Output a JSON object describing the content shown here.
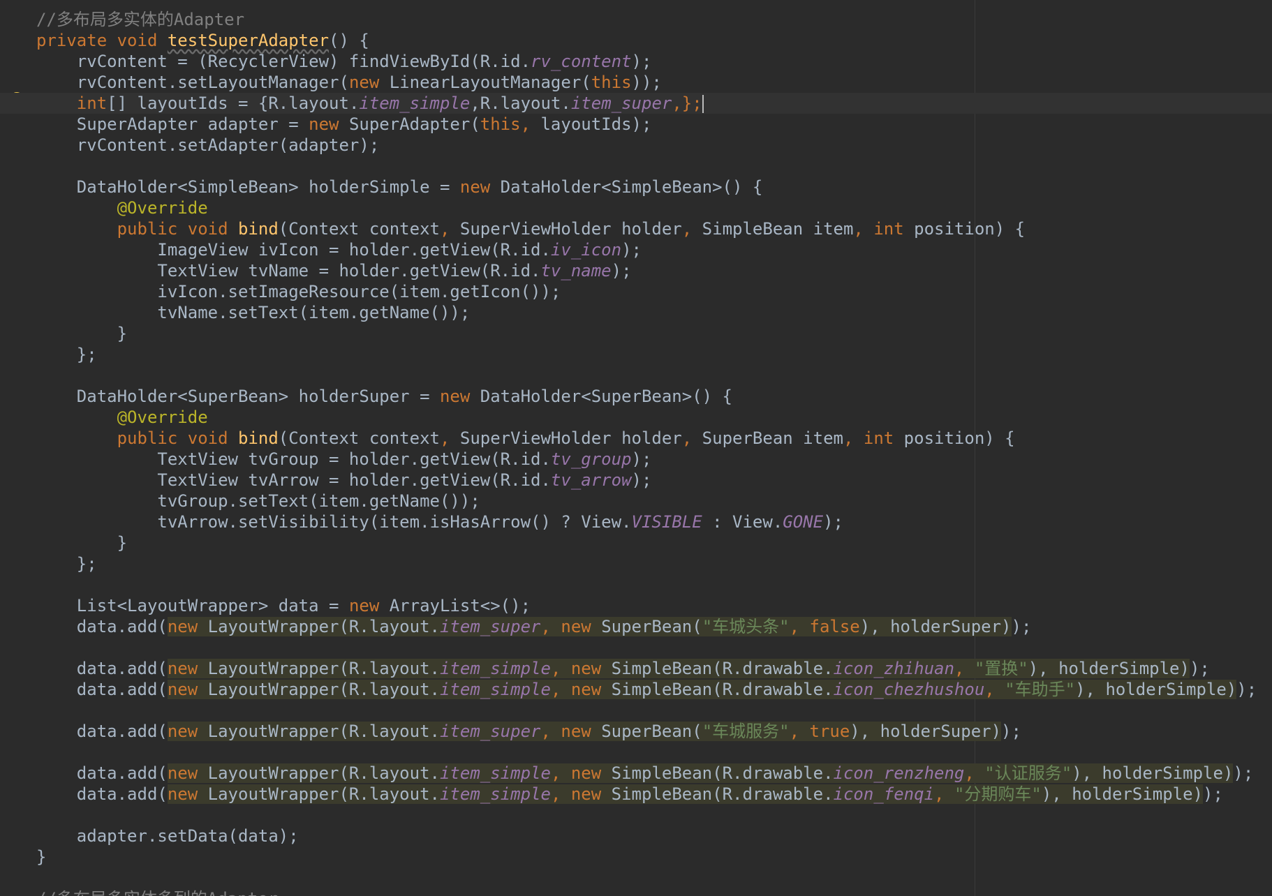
{
  "editor": {
    "lines": [
      [
        {
          "t": "//多布局多实体的Adapter",
          "c": "cm"
        }
      ],
      [
        {
          "t": "private void ",
          "c": "kw"
        },
        {
          "t": "testSuperAdapter",
          "c": "fn uline"
        },
        {
          "t": "() {",
          "c": "pl"
        }
      ],
      [
        {
          "t": "    rvContent = (RecyclerView) findViewById(R.id.",
          "c": "pl"
        },
        {
          "t": "rv_content",
          "c": "fd"
        },
        {
          "t": ");",
          "c": "pl"
        }
      ],
      [
        {
          "t": "    rvContent.setLayoutManager(",
          "c": "pl"
        },
        {
          "t": "new ",
          "c": "kw"
        },
        {
          "t": "LinearLayoutManager(",
          "c": "pl"
        },
        {
          "t": "this",
          "c": "kw"
        },
        {
          "t": "));",
          "c": "pl"
        }
      ],
      [
        {
          "t": "    ",
          "c": "pl"
        },
        {
          "t": "int",
          "c": "kw"
        },
        {
          "t": "[] layoutIds = {R.layout.",
          "c": "pl"
        },
        {
          "t": "item_simple",
          "c": "fd"
        },
        {
          "t": ",R.layout.",
          "c": "pl"
        },
        {
          "t": "item_super",
          "c": "fd"
        },
        {
          "t": ",};",
          "c": "kw"
        }
      ],
      [
        {
          "t": "    SuperAdapter adapter = ",
          "c": "pl"
        },
        {
          "t": "new ",
          "c": "kw"
        },
        {
          "t": "SuperAdapter(",
          "c": "pl"
        },
        {
          "t": "this",
          "c": "kw"
        },
        {
          "t": ", ",
          "c": "kw"
        },
        {
          "t": "layoutIds);",
          "c": "pl"
        }
      ],
      [
        {
          "t": "    rvContent.setAdapter(adapter);",
          "c": "pl"
        }
      ],
      [
        {
          "t": "",
          "c": "pl"
        }
      ],
      [
        {
          "t": "    DataHolder<SimpleBean> holderSimple = ",
          "c": "pl"
        },
        {
          "t": "new ",
          "c": "kw"
        },
        {
          "t": "DataHolder<SimpleBean>() {",
          "c": "pl"
        }
      ],
      [
        {
          "t": "        ",
          "c": "pl"
        },
        {
          "t": "@Override",
          "c": "an"
        }
      ],
      [
        {
          "t": "        ",
          "c": "pl"
        },
        {
          "t": "public void ",
          "c": "kw"
        },
        {
          "t": "bind",
          "c": "fn"
        },
        {
          "t": "(Context context",
          "c": "pl"
        },
        {
          "t": ", ",
          "c": "kw"
        },
        {
          "t": "SuperViewHolder holder",
          "c": "pl"
        },
        {
          "t": ", ",
          "c": "kw"
        },
        {
          "t": "SimpleBean item",
          "c": "pl"
        },
        {
          "t": ", int ",
          "c": "kw"
        },
        {
          "t": "position) {",
          "c": "pl"
        }
      ],
      [
        {
          "t": "            ImageView ivIcon = holder.getView(R.id.",
          "c": "pl"
        },
        {
          "t": "iv_icon",
          "c": "fd"
        },
        {
          "t": ");",
          "c": "pl"
        }
      ],
      [
        {
          "t": "            TextView tvName = holder.getView(R.id.",
          "c": "pl"
        },
        {
          "t": "tv_name",
          "c": "fd"
        },
        {
          "t": ");",
          "c": "pl"
        }
      ],
      [
        {
          "t": "            ivIcon.setImageResource(item.getIcon());",
          "c": "pl"
        }
      ],
      [
        {
          "t": "            tvName.setText(item.getName());",
          "c": "pl"
        }
      ],
      [
        {
          "t": "        }",
          "c": "pl"
        }
      ],
      [
        {
          "t": "    };",
          "c": "pl"
        }
      ],
      [
        {
          "t": "",
          "c": "pl"
        }
      ],
      [
        {
          "t": "    DataHolder<SuperBean> holderSuper = ",
          "c": "pl"
        },
        {
          "t": "new ",
          "c": "kw"
        },
        {
          "t": "DataHolder<SuperBean>() {",
          "c": "pl"
        }
      ],
      [
        {
          "t": "        ",
          "c": "pl"
        },
        {
          "t": "@Override",
          "c": "an"
        }
      ],
      [
        {
          "t": "        ",
          "c": "pl"
        },
        {
          "t": "public void ",
          "c": "kw"
        },
        {
          "t": "bind",
          "c": "fn"
        },
        {
          "t": "(Context context",
          "c": "pl"
        },
        {
          "t": ", ",
          "c": "kw"
        },
        {
          "t": "SuperViewHolder holder",
          "c": "pl"
        },
        {
          "t": ", ",
          "c": "kw"
        },
        {
          "t": "SuperBean item",
          "c": "pl"
        },
        {
          "t": ", int ",
          "c": "kw"
        },
        {
          "t": "position) {",
          "c": "pl"
        }
      ],
      [
        {
          "t": "            TextView tvGroup = holder.getView(R.id.",
          "c": "pl"
        },
        {
          "t": "tv_group",
          "c": "fd"
        },
        {
          "t": ");",
          "c": "pl"
        }
      ],
      [
        {
          "t": "            TextView tvArrow = holder.getView(R.id.",
          "c": "pl"
        },
        {
          "t": "tv_arrow",
          "c": "fd"
        },
        {
          "t": ");",
          "c": "pl"
        }
      ],
      [
        {
          "t": "            tvGroup.setText(item.getName());",
          "c": "pl"
        }
      ],
      [
        {
          "t": "            tvArrow.setVisibility(item.isHasArrow() ? View.",
          "c": "pl"
        },
        {
          "t": "VISIBLE",
          "c": "fd"
        },
        {
          "t": " : View.",
          "c": "pl"
        },
        {
          "t": "GONE",
          "c": "fd"
        },
        {
          "t": ");",
          "c": "pl"
        }
      ],
      [
        {
          "t": "        }",
          "c": "pl"
        }
      ],
      [
        {
          "t": "    };",
          "c": "pl"
        }
      ],
      [
        {
          "t": "",
          "c": "pl"
        }
      ],
      [
        {
          "t": "    List<LayoutWrapper> data = ",
          "c": "pl"
        },
        {
          "t": "new ",
          "c": "kw"
        },
        {
          "t": "ArrayList<>();",
          "c": "pl"
        }
      ],
      [
        {
          "t": "    data.add(",
          "c": "pl"
        },
        {
          "t": "new ",
          "c": "kw hl"
        },
        {
          "t": "LayoutWrapper(R.layout.",
          "c": "pl hl"
        },
        {
          "t": "item_super",
          "c": "fd hl"
        },
        {
          "t": ", new ",
          "c": "kw hl"
        },
        {
          "t": "SuperBean(",
          "c": "pl hl"
        },
        {
          "t": "\"车城头条\"",
          "c": "st hl"
        },
        {
          "t": ", false",
          "c": "kw hl"
        },
        {
          "t": "), ",
          "c": "pl hl"
        },
        {
          "t": "holderSuper)",
          "c": "pl hl"
        },
        {
          "t": ");",
          "c": "pl"
        }
      ],
      [
        {
          "t": "",
          "c": "pl"
        }
      ],
      [
        {
          "t": "    data.add(",
          "c": "pl"
        },
        {
          "t": "new ",
          "c": "kw hl"
        },
        {
          "t": "LayoutWrapper(R.layout.",
          "c": "pl hl"
        },
        {
          "t": "item_simple",
          "c": "fd hl"
        },
        {
          "t": ", new ",
          "c": "kw hl"
        },
        {
          "t": "SimpleBean(R.drawable.",
          "c": "pl hl"
        },
        {
          "t": "icon_zhihuan",
          "c": "fd hl"
        },
        {
          "t": ", ",
          "c": "kw hl"
        },
        {
          "t": "\"置换\"",
          "c": "st hl"
        },
        {
          "t": "), ",
          "c": "pl hl"
        },
        {
          "t": "holderSimple)",
          "c": "pl hl"
        },
        {
          "t": ");",
          "c": "pl"
        }
      ],
      [
        {
          "t": "    data.add(",
          "c": "pl"
        },
        {
          "t": "new ",
          "c": "kw hl"
        },
        {
          "t": "LayoutWrapper(R.layout.",
          "c": "pl hl"
        },
        {
          "t": "item_simple",
          "c": "fd hl"
        },
        {
          "t": ", new ",
          "c": "kw hl"
        },
        {
          "t": "SimpleBean(R.drawable.",
          "c": "pl hl"
        },
        {
          "t": "icon_chezhushou",
          "c": "fd hl"
        },
        {
          "t": ", ",
          "c": "kw hl"
        },
        {
          "t": "\"车助手\"",
          "c": "st hl"
        },
        {
          "t": "), ",
          "c": "pl hl"
        },
        {
          "t": "holderSimple)",
          "c": "pl hl"
        },
        {
          "t": ");",
          "c": "pl"
        }
      ],
      [
        {
          "t": "",
          "c": "pl"
        }
      ],
      [
        {
          "t": "    data.add(",
          "c": "pl"
        },
        {
          "t": "new ",
          "c": "kw hl"
        },
        {
          "t": "LayoutWrapper(R.layout.",
          "c": "pl hl"
        },
        {
          "t": "item_super",
          "c": "fd hl"
        },
        {
          "t": ", new ",
          "c": "kw hl"
        },
        {
          "t": "SuperBean(",
          "c": "pl hl"
        },
        {
          "t": "\"车城服务\"",
          "c": "st hl"
        },
        {
          "t": ", true",
          "c": "kw hl"
        },
        {
          "t": "), ",
          "c": "pl hl"
        },
        {
          "t": "holderSuper)",
          "c": "pl hl"
        },
        {
          "t": ");",
          "c": "pl"
        }
      ],
      [
        {
          "t": "",
          "c": "pl"
        }
      ],
      [
        {
          "t": "    data.add(",
          "c": "pl"
        },
        {
          "t": "new ",
          "c": "kw hl"
        },
        {
          "t": "LayoutWrapper(R.layout.",
          "c": "pl hl"
        },
        {
          "t": "item_simple",
          "c": "fd hl"
        },
        {
          "t": ", new ",
          "c": "kw hl"
        },
        {
          "t": "SimpleBean(R.drawable.",
          "c": "pl hl"
        },
        {
          "t": "icon_renzheng",
          "c": "fd hl"
        },
        {
          "t": ", ",
          "c": "kw hl"
        },
        {
          "t": "\"认证服务\"",
          "c": "st hl"
        },
        {
          "t": "), ",
          "c": "pl hl"
        },
        {
          "t": "holderSimple)",
          "c": "pl hl"
        },
        {
          "t": ");",
          "c": "pl"
        }
      ],
      [
        {
          "t": "    data.add(",
          "c": "pl"
        },
        {
          "t": "new ",
          "c": "kw hl"
        },
        {
          "t": "LayoutWrapper(R.layout.",
          "c": "pl hl"
        },
        {
          "t": "item_simple",
          "c": "fd hl"
        },
        {
          "t": ", new ",
          "c": "kw hl"
        },
        {
          "t": "SimpleBean(R.drawable.",
          "c": "pl hl"
        },
        {
          "t": "icon_fenqi",
          "c": "fd hl"
        },
        {
          "t": ", ",
          "c": "kw hl"
        },
        {
          "t": "\"分期购车\"",
          "c": "st hl"
        },
        {
          "t": "), ",
          "c": "pl hl"
        },
        {
          "t": "holderSimple)",
          "c": "pl hl"
        },
        {
          "t": ");",
          "c": "pl"
        }
      ],
      [
        {
          "t": "",
          "c": "pl"
        }
      ],
      [
        {
          "t": "    adapter.setData(data);",
          "c": "pl"
        }
      ],
      [
        {
          "t": "}",
          "c": "pl"
        }
      ],
      [
        {
          "t": "",
          "c": "pl"
        }
      ],
      [
        {
          "t": "//多布局多实体多列的Adapter",
          "c": "cm"
        }
      ]
    ],
    "current_line": 4,
    "colors": {
      "background": "#2b2b2b",
      "keyword": "#cc7832",
      "comment": "#808080",
      "method": "#ffc66d",
      "annotation": "#bbb529",
      "field": "#9876aa",
      "string": "#6a8759",
      "plain": "#a9b7c6"
    },
    "icons": {
      "gutter": "lightbulb-icon"
    }
  }
}
